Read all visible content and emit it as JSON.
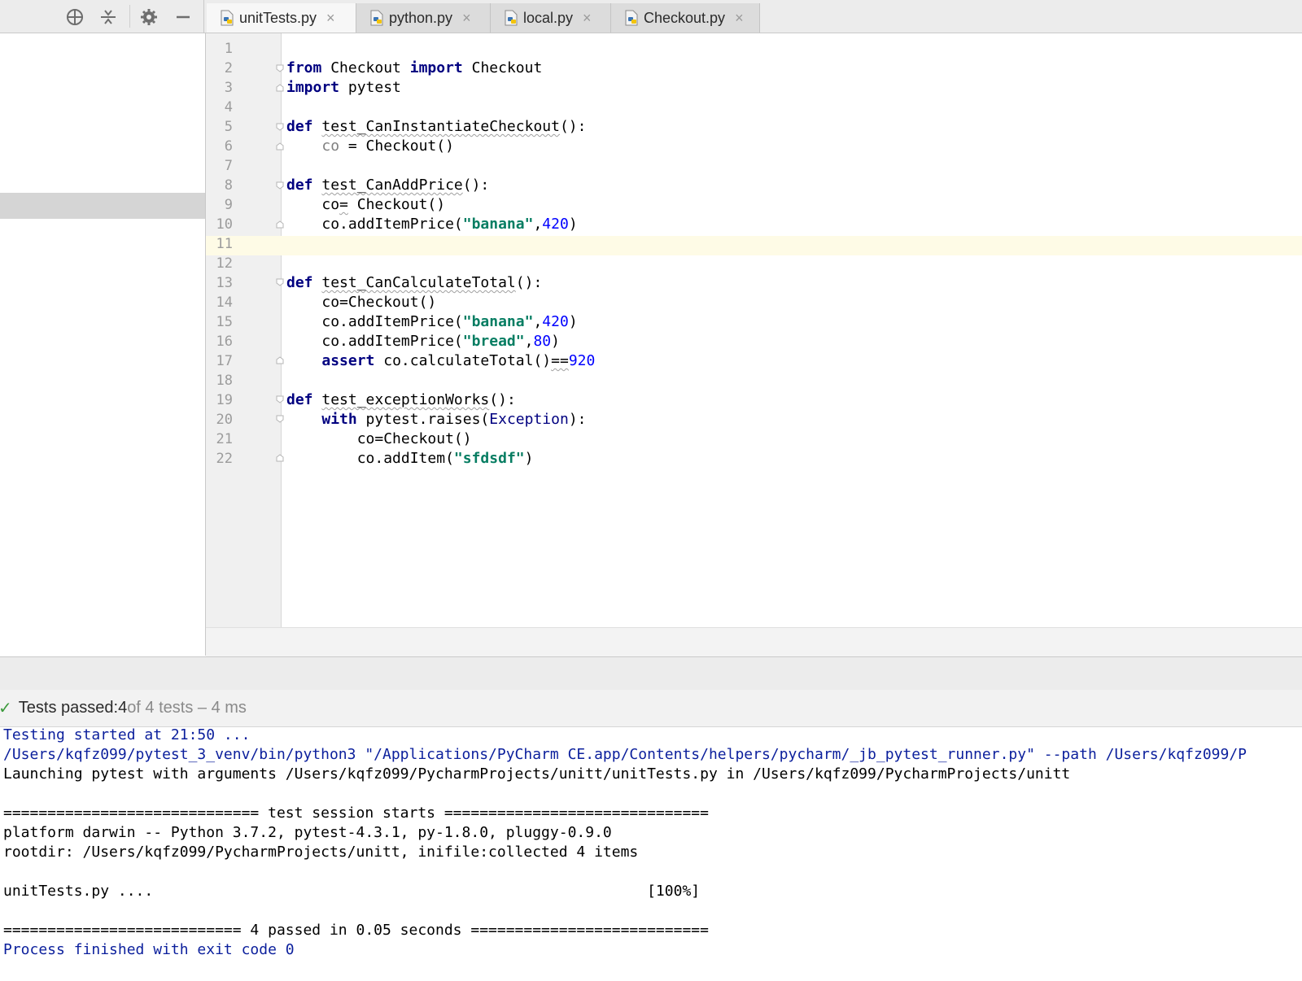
{
  "tabs": [
    {
      "label": "unitTests.py",
      "close": "×",
      "active": true
    },
    {
      "label": "python.py",
      "close": "×",
      "active": false
    },
    {
      "label": "local.py",
      "close": "×",
      "active": false
    },
    {
      "label": "Checkout.py",
      "close": "×",
      "active": false
    }
  ],
  "toolbar": {
    "icons": [
      "crosshair-icon",
      "collapse-icon",
      "gear-icon",
      "minimize-icon"
    ]
  },
  "editor": {
    "line_numbers": [
      "1",
      "2",
      "3",
      "4",
      "5",
      "6",
      "7",
      "8",
      "9",
      "10",
      "11",
      "12",
      "13",
      "14",
      "15",
      "16",
      "17",
      "18",
      "19",
      "20",
      "21",
      "22"
    ],
    "current_line": "11",
    "code": {
      "l2": {
        "kw1": "from",
        "t1": " Checkout ",
        "kw2": "import",
        "t2": " Checkout"
      },
      "l3": {
        "kw1": "import",
        "t1": " pytest"
      },
      "l5": {
        "kw1": "def",
        "name": "test_CanInstantiateCheckout",
        "rest": "():"
      },
      "l6": {
        "var": "co",
        "t1": " = Checkout()"
      },
      "l8": {
        "kw1": "def",
        "name": "test_CanAddPrice",
        "rest": "():"
      },
      "l9": {
        "t1": "co",
        "t2": "=",
        "t3": " Checkout()"
      },
      "l10": {
        "t1": "co.addItemPrice(",
        "s1": "\"banana\"",
        "t2": ",",
        "n1": "420",
        "t3": ")"
      },
      "l13": {
        "kw1": "def",
        "name": "test_CanCalculateTotal",
        "rest": "():"
      },
      "l14": {
        "t1": "co=Checkout()"
      },
      "l15": {
        "t1": "co.addItemPrice(",
        "s1": "\"banana\"",
        "t2": ",",
        "n1": "420",
        "t3": ")"
      },
      "l16": {
        "t1": "co.addItemPrice(",
        "s1": "\"bread\"",
        "t2": ",",
        "n1": "80",
        "t3": ")"
      },
      "l17": {
        "kw1": "assert",
        "t1": " co.calculateTotal()",
        "op": "==",
        "n1": "920"
      },
      "l19": {
        "kw1": "def",
        "name": "test_exceptionWorks",
        "rest": "():"
      },
      "l20": {
        "kw1": "with",
        "t1": " pytest.raises(",
        "b1": "Exception",
        "t2": "):"
      },
      "l21": {
        "t1": "co=Checkout()"
      },
      "l22": {
        "t1": "co.addItem(",
        "s1": "\"sfdsdf\"",
        "t2": ")"
      }
    }
  },
  "status": {
    "label": "Tests passed: ",
    "passed": "4",
    "rest": " of 4 tests – 4 ms"
  },
  "console": {
    "lines": [
      "Testing started at 21:50 ...",
      "/Users/kqfz099/pytest_3_venv/bin/python3 \"/Applications/PyCharm CE.app/Contents/helpers/pycharm/_jb_pytest_runner.py\" --path /Users/kqfz099/P",
      "Launching pytest with arguments /Users/kqfz099/PycharmProjects/unitt/unitTests.py in /Users/kqfz099/PycharmProjects/unitt",
      "",
      "============================= test session starts ==============================",
      "platform darwin -- Python 3.7.2, pytest-4.3.1, py-1.8.0, pluggy-0.9.0",
      "rootdir: /Users/kqfz099/PycharmProjects/unitt, inifile:collected 4 items",
      "",
      "unitTests.py ....                                                        [100%]",
      "",
      "=========================== 4 passed in 0.05 seconds ===========================",
      "Process finished with exit code 0"
    ]
  },
  "colors": {
    "keyword": "#000080",
    "string": "#067d62",
    "number": "#0000ff",
    "console_blue": "#0b1f9c",
    "pass_green": "#3c9a3c"
  }
}
